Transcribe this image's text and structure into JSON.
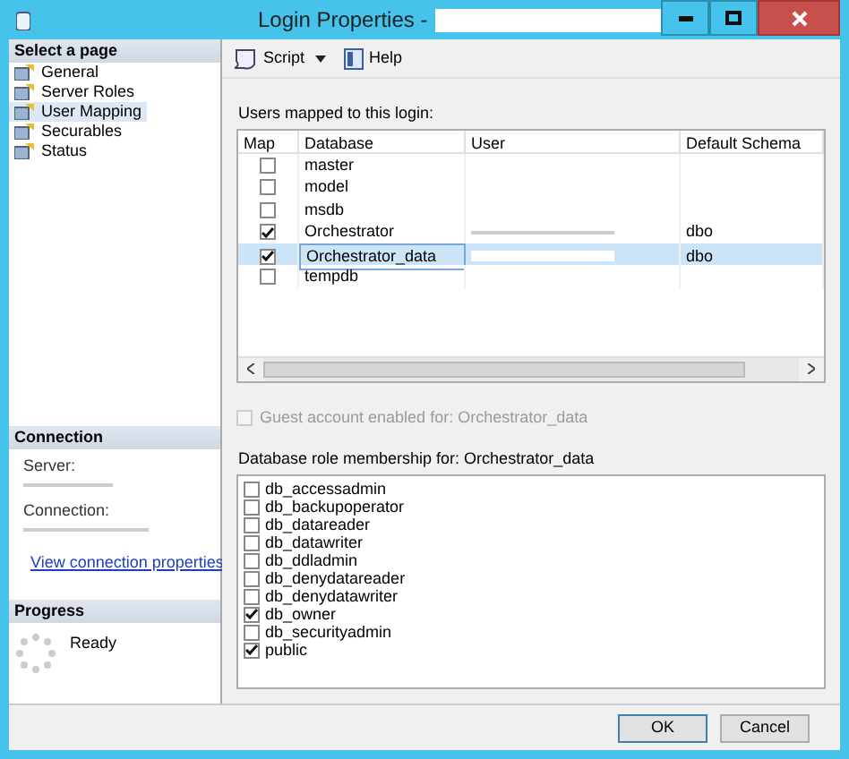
{
  "window": {
    "title": "Login Properties -"
  },
  "sidebar": {
    "header": "Select a page",
    "items": [
      {
        "label": "General",
        "selected": false
      },
      {
        "label": "Server Roles",
        "selected": false
      },
      {
        "label": "User Mapping",
        "selected": true
      },
      {
        "label": "Securables",
        "selected": false
      },
      {
        "label": "Status",
        "selected": false
      }
    ]
  },
  "connection": {
    "header": "Connection",
    "server_label": "Server:",
    "connection_label": "Connection:",
    "link": "View connection properties"
  },
  "progress": {
    "header": "Progress",
    "status": "Ready"
  },
  "toolbar": {
    "script": "Script",
    "help": "Help"
  },
  "users_label": "Users mapped to this login:",
  "table": {
    "columns": [
      "Map",
      "Database",
      "User",
      "Default Schema"
    ],
    "rows": [
      {
        "database": "master",
        "checked": false,
        "selected": false,
        "user_redacted": false,
        "schema": ""
      },
      {
        "database": "model",
        "checked": false,
        "selected": false,
        "user_redacted": false,
        "schema": ""
      },
      {
        "database": "msdb",
        "checked": false,
        "selected": false,
        "user_redacted": false,
        "schema": ""
      },
      {
        "database": "Orchestrator",
        "checked": true,
        "selected": false,
        "user_redacted": true,
        "schema": "dbo"
      },
      {
        "database": "Orchestrator_data",
        "checked": true,
        "selected": true,
        "user_redacted": true,
        "schema": "dbo"
      },
      {
        "database": "tempdb",
        "checked": false,
        "selected": false,
        "user_redacted": false,
        "schema": ""
      }
    ]
  },
  "guest": {
    "label": "Guest account enabled for: Orchestrator_data",
    "checked": false,
    "disabled": true
  },
  "roles_label": "Database role membership for: Orchestrator_data",
  "roles": [
    {
      "label": "db_accessadmin",
      "checked": false
    },
    {
      "label": "db_backupoperator",
      "checked": false
    },
    {
      "label": "db_datareader",
      "checked": false
    },
    {
      "label": "db_datawriter",
      "checked": false
    },
    {
      "label": "db_ddladmin",
      "checked": false
    },
    {
      "label": "db_denydatareader",
      "checked": false
    },
    {
      "label": "db_denydatawriter",
      "checked": false
    },
    {
      "label": "db_owner",
      "checked": true
    },
    {
      "label": "db_securityadmin",
      "checked": false
    },
    {
      "label": "public",
      "checked": true
    }
  ],
  "buttons": [
    {
      "label": "OK",
      "default": true
    },
    {
      "label": "Cancel",
      "default": false
    }
  ]
}
